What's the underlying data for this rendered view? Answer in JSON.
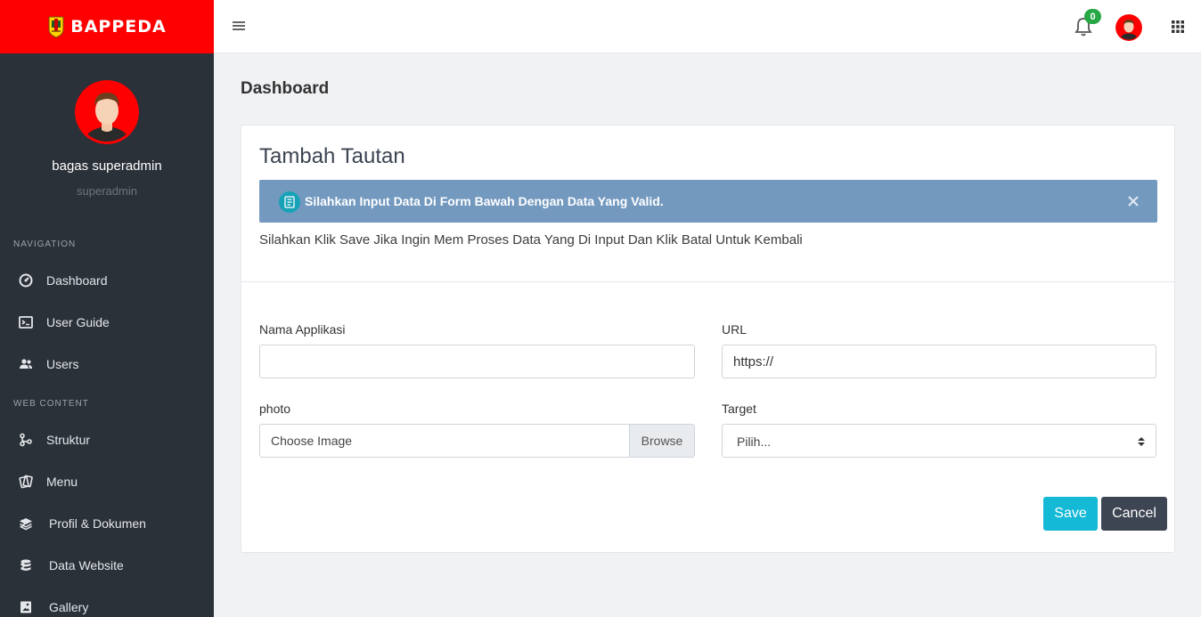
{
  "brand": {
    "name": "BAPPEDA"
  },
  "colors": {
    "brand": "#ff0000",
    "sidebar": "#2b3139",
    "alert": "#7399bf",
    "save": "#14b9d6",
    "cancel": "#3d4452",
    "badge": "#28a745"
  },
  "profile": {
    "name": "bagas superadmin",
    "role": "superadmin"
  },
  "sidebar": {
    "section_navigation": "NAVIGATION",
    "section_web_content": "WEB CONTENT",
    "items": [
      {
        "label": "Dashboard",
        "icon": "dashboard-gauge-icon"
      },
      {
        "label": "User Guide",
        "icon": "terminal-icon"
      },
      {
        "label": "Users",
        "icon": "users-icon"
      },
      {
        "label": "Struktur",
        "icon": "branch-icon"
      },
      {
        "label": "Menu",
        "icon": "cards-icon"
      },
      {
        "label": "Profil & Dokumen",
        "icon": "layers-icon",
        "has_submenu": true
      },
      {
        "label": "Data Website",
        "icon": "database-icon",
        "has_submenu": true
      },
      {
        "label": "Gallery",
        "icon": "image-icon",
        "has_submenu": true
      }
    ]
  },
  "topbar": {
    "notification_count": "0"
  },
  "page": {
    "title": "Dashboard"
  },
  "card": {
    "title": "Tambah Tautan",
    "alert": "Silahkan Input Data Di Form Bawah Dengan Data Yang Valid.",
    "subtitle": "Silahkan Klik Save Jika Ingin Mem Proses Data Yang Di Input Dan Klik Batal Untuk Kembali"
  },
  "form": {
    "nama_label": "Nama Applikasi",
    "nama_value": "",
    "url_label": "URL",
    "url_value": "https://",
    "photo_label": "photo",
    "photo_placeholder": "Choose Image",
    "browse_label": "Browse",
    "target_label": "Target",
    "target_selected": "Pilih..."
  },
  "actions": {
    "save": "Save",
    "cancel": "Cancel"
  }
}
